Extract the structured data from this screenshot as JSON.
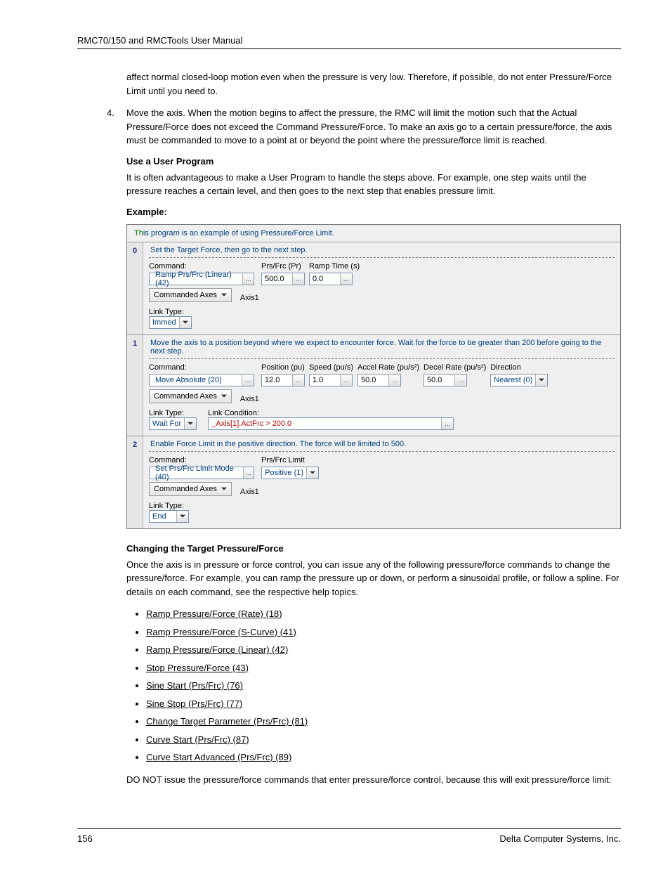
{
  "header": "RMC70/150 and RMCTools User Manual",
  "intro_cont": "affect normal closed-loop motion even when the pressure is very low. Therefore, if possible, do not enter Pressure/Force Limit until you need to.",
  "item4_num": "4.",
  "item4": "Move the axis. When the motion begins to affect the pressure, the RMC will limit the motion such that the Actual Pressure/Force does not exceed the Command Pressure/Force. To make an axis go to a certain pressure/force, the axis must be commanded to move to a point at or beyond the point where the pressure/force limit is reached.",
  "use_head": "Use a User Program",
  "use_body": "It is often advantageous to make a User Program to handle the steps above. For example, one step waits until the pressure reaches a certain level, and then goes to the next step that enables pressure limit.",
  "example_head": "Example:",
  "program": {
    "title_th": "Th",
    "title_rest": "is program is an example of using Pressure/Force Limit.",
    "labels": {
      "command": "Command:",
      "prsfrc": "Prs/Frc (Pr)",
      "ramptime": "Ramp Time (s)",
      "position": "Position (pu)",
      "speed": "Speed (pu/s)",
      "accel": "Accel Rate (pu/s²)",
      "decel": "Decel Rate (pu/s²)",
      "direction": "Direction",
      "prsfrclimit": "Prs/Frc Limit",
      "cmdaxes": "Commanded Axes",
      "axis1": "Axis1",
      "linktype": "Link Type:",
      "linkcond": "Link Condition:"
    },
    "steps": [
      {
        "num": "0",
        "desc": "Set the Target Force, then go to the next step.",
        "cmd": "Ramp Prs/Frc (Linear) (42)",
        "params": [
          {
            "label_key": "prsfrc",
            "value": "500.0"
          },
          {
            "label_key": "ramptime",
            "value": "0.0"
          }
        ],
        "linktype": "Immed"
      },
      {
        "num": "1",
        "desc": "Move the axis to a position beyond where we expect to encounter force. Wait for the force to be greater than 200 before going to the next step.",
        "cmd": "Move Absolute (20)",
        "params": [
          {
            "label_key": "position",
            "value": "12.0"
          },
          {
            "label_key": "speed",
            "value": "1.0"
          },
          {
            "label_key": "accel",
            "value": "50.0"
          },
          {
            "label_key": "decel",
            "value": "50.0"
          }
        ],
        "direction": "Nearest (0)",
        "linktype": "Wait For",
        "linkcond": "_Axis[1].ActFrc > 200.0"
      },
      {
        "num": "2",
        "desc": "Enable Force Limit in the positive direction. The force will be limited to 500.",
        "cmd": "Set Prs/Frc Limit Mode (40)",
        "prsfrclimit": "Positive (1)",
        "linktype": "End"
      }
    ]
  },
  "changing_head": "Changing the Target Pressure/Force",
  "changing_body": "Once the axis is in pressure or force control, you can issue any of the following pressure/force commands to change the pressure/force. For example, you can ramp the pressure up or down, or perform a sinusoidal profile, or follow a spline. For details on each command, see the respective help topics.",
  "cmd_links": [
    "Ramp Pressure/Force (Rate) (18)",
    "Ramp Pressure/Force (S-Curve) (41)",
    "Ramp Pressure/Force (Linear) (42)",
    "Stop Pressure/Force (43)",
    "Sine Start (Prs/Frc) (76)",
    "Sine Stop (Prs/Frc) (77)",
    "Change Target Parameter (Prs/Frc) (81)",
    "Curve Start (Prs/Frc) (87)",
    "Curve Start Advanced (Prs/Frc) (89)"
  ],
  "donot": "DO NOT issue the pressure/force commands that enter pressure/force control, because this will exit pressure/force limit:",
  "footer_left": "156",
  "footer_right": "Delta Computer Systems, Inc."
}
